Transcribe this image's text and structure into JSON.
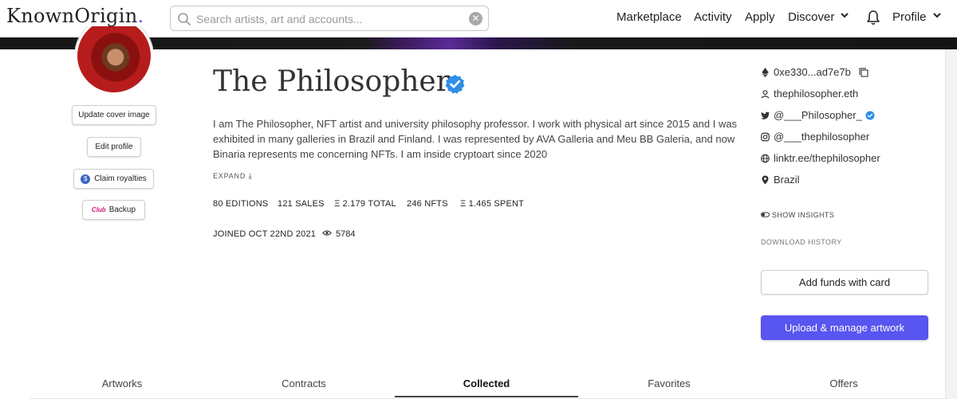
{
  "header": {
    "logo": "KnownOrigin",
    "logo_dot": ".",
    "search_placeholder": "Search artists, art and accounts...",
    "nav": {
      "marketplace": "Marketplace",
      "activity": "Activity",
      "apply": "Apply",
      "discover": "Discover",
      "profile": "Profile"
    }
  },
  "left": {
    "update_cover": "Update cover image",
    "edit_profile": "Edit profile",
    "claim_royalties": "Claim royalties",
    "backup": "Backup",
    "backup_icon_text": "Club"
  },
  "profile": {
    "name": "The Philosopher",
    "bio": "I am The Philosopher, NFT artist and university philosophy professor. I work with physical art since 2015 and I was exhibited in many galleries in Brazil and Finland. I was represented by AVA Galleria and Meu BB Galeria, and now Binaria represents me concerning NFTs. I am inside cryptoart since 2020",
    "expand": "EXPAND",
    "stats": {
      "editions": "80 EDITIONS",
      "sales": "121 SALES",
      "total": "Ξ 2.179 TOTAL",
      "nfts": "246 NFTS",
      "spent": "Ξ 1.465 SPENT"
    },
    "joined": "JOINED OCT 22ND 2021",
    "views": "5784"
  },
  "right": {
    "address": "0xe330...ad7e7b",
    "ens": "thephilosopher.eth",
    "twitter": "@___Philosopher_",
    "instagram": "@___thephilosopher",
    "website": "linktr.ee/thephilosopher",
    "location": "Brazil",
    "show_insights": "SHOW INSIGHTS",
    "download_history": "DOWNLOAD HISTORY",
    "add_funds": "Add funds with card",
    "upload": "Upload & manage artwork"
  },
  "tabs": [
    "Artworks",
    "Contracts",
    "Collected",
    "Favorites",
    "Offers"
  ],
  "active_tab": "Collected",
  "colors": {
    "accent": "#5855f0",
    "verified": "#2f8fe6"
  }
}
